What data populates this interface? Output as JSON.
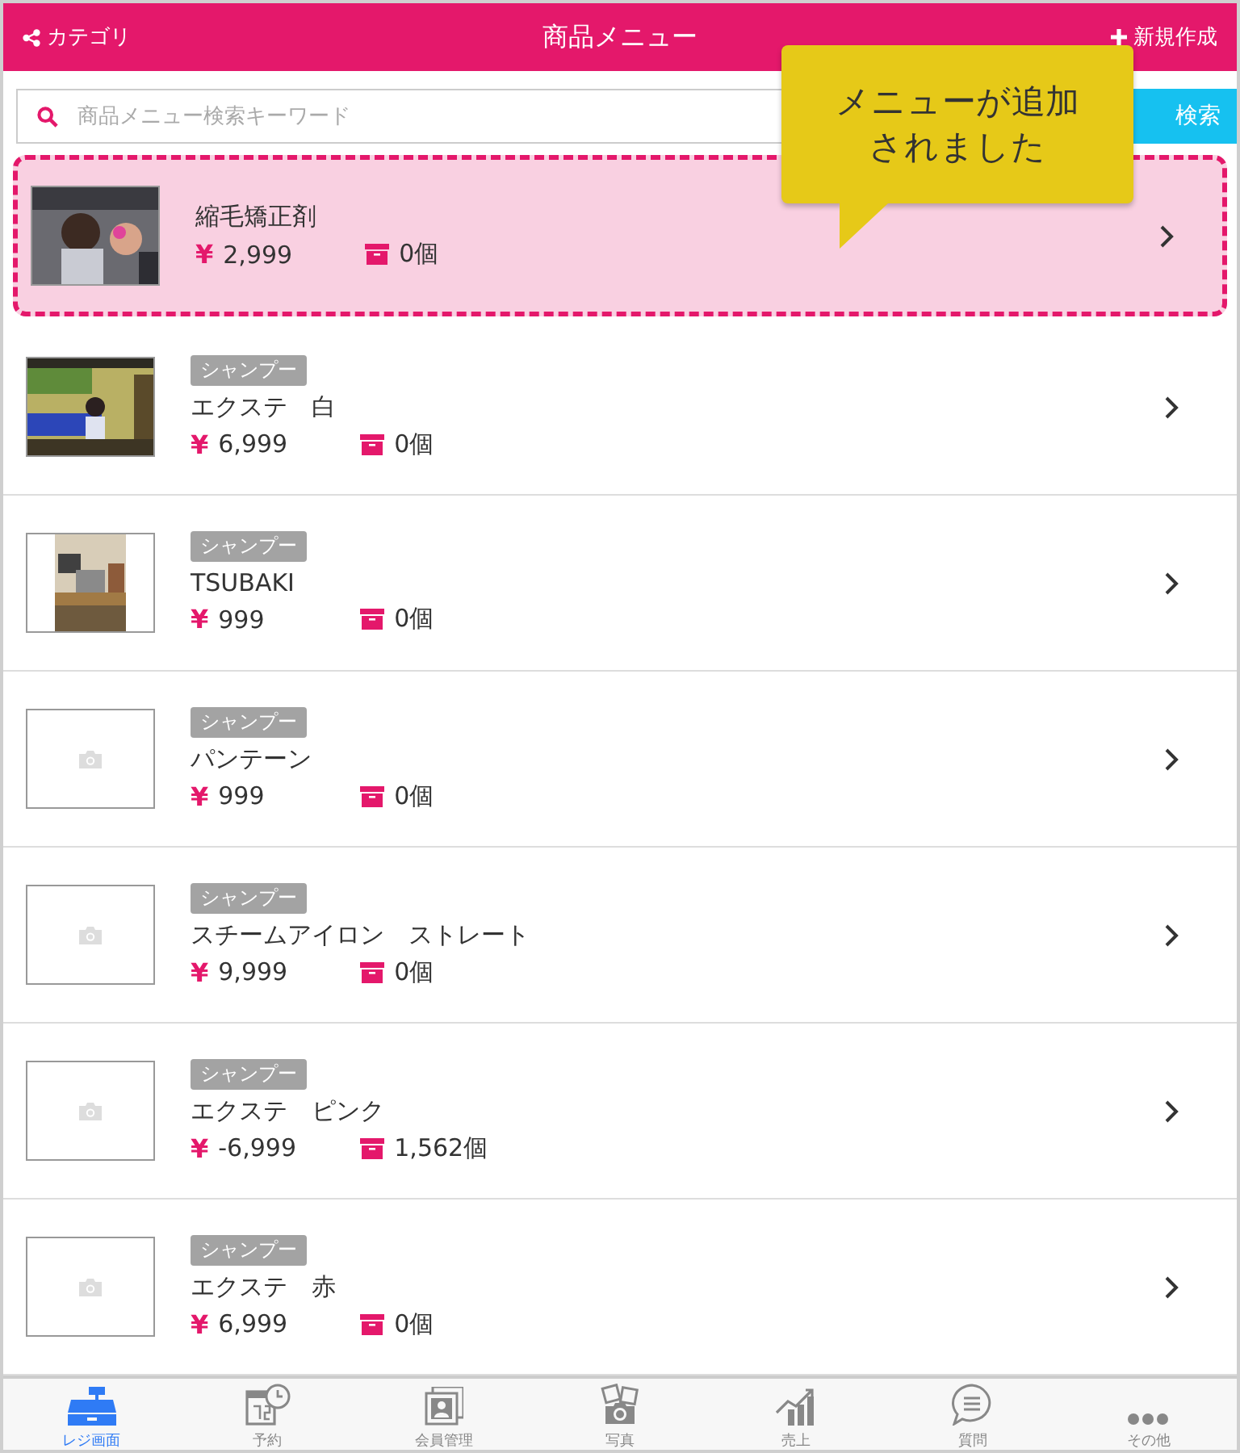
{
  "header": {
    "left": "カテゴリ",
    "title": "商品メニュー",
    "right": "新規作成"
  },
  "search": {
    "placeholder": "商品メニュー検索キーワード",
    "button": "検索"
  },
  "toast": {
    "lines": [
      "メニューが追加",
      "されました"
    ]
  },
  "products": [
    {
      "kind": "picture",
      "highlighted": true,
      "name": "縮毛矯正剤",
      "price": "2,999",
      "stock": "0個"
    },
    {
      "kind": "picture",
      "highlighted": false,
      "category": "シャンプー",
      "name": "エクステ　白",
      "price": "6,999",
      "stock": "0個"
    },
    {
      "kind": "picture",
      "highlighted": false,
      "category": "シャンプー",
      "name": "TSUBAKI",
      "price": "999",
      "stock": "0個"
    },
    {
      "kind": "empty",
      "highlighted": false,
      "category": "シャンプー",
      "name": "パンテーン",
      "price": "999",
      "stock": "0個"
    },
    {
      "kind": "empty",
      "highlighted": false,
      "category": "シャンプー",
      "name": "スチームアイロン　ストレート",
      "price": "9,999",
      "stock": "0個"
    },
    {
      "kind": "empty",
      "highlighted": false,
      "category": "シャンプー",
      "name": "エクステ　ピンク",
      "price": "-6,999",
      "stock": "1,562個"
    },
    {
      "kind": "empty",
      "highlighted": false,
      "category": "シャンプー",
      "name": "エクステ　赤",
      "price": "6,999",
      "stock": "0個"
    }
  ],
  "currency": "¥",
  "tabs": [
    {
      "kind": "register",
      "label": "レジ画面",
      "selected": true
    },
    {
      "kind": "calendar",
      "label": "予約",
      "selected": false
    },
    {
      "kind": "member",
      "label": "会員管理",
      "selected": false
    },
    {
      "kind": "camera",
      "label": "写真",
      "selected": false
    },
    {
      "kind": "chart",
      "label": "売上",
      "selected": false
    },
    {
      "kind": "chat",
      "label": "質問",
      "selected": false
    },
    {
      "kind": "more",
      "label": "その他",
      "selected": false
    }
  ]
}
